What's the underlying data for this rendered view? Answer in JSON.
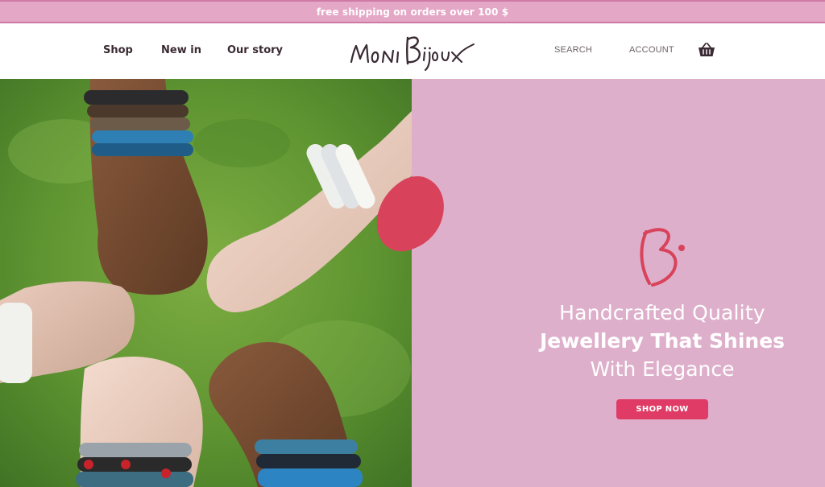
{
  "promo": {
    "text": "free shipping on orders over 100 $"
  },
  "nav": {
    "items": [
      {
        "label": "Shop"
      },
      {
        "label": "New in"
      },
      {
        "label": "Our story"
      }
    ]
  },
  "logo": {
    "text": "MONI Bijoux"
  },
  "utility": {
    "search_label": "SEARCH",
    "account_label": "ACCOUNT",
    "cart_icon": "basket-icon"
  },
  "hero": {
    "headline_line1": "Handcrafted Quality",
    "headline_line2": "Jewellery That Shines",
    "headline_line3": "With Elegance",
    "cta_label": "SHOP NOW",
    "monogram_icon": "b-monogram-icon",
    "image": "bracelet-hands-photo"
  },
  "colors": {
    "promo_bg": "#e4a7c6",
    "panel_bg": "#deafcb",
    "accent": "#e03b66",
    "nav_text": "#3a2a33"
  }
}
